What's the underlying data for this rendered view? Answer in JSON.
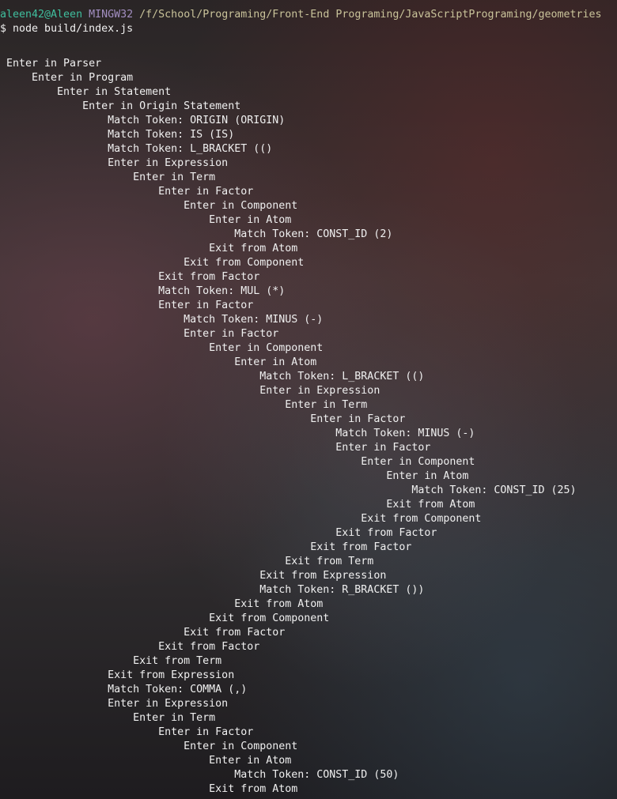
{
  "prompt": {
    "user": "aleen42@Aleen",
    "system": "MINGW32",
    "path": "/f/School/Programing/Front-End Programing/JavaScriptPrograming/geometries",
    "symbol": "$",
    "command": "node build/index.js"
  },
  "colors": {
    "user": "#3fbf9e",
    "system": "#a38fc2",
    "path": "#c9c39a",
    "text": "#f0f0f0"
  },
  "output": [
    "Enter in Parser",
    "    Enter in Program",
    "        Enter in Statement",
    "            Enter in Origin Statement",
    "                Match Token: ORIGIN (ORIGIN)",
    "                Match Token: IS (IS)",
    "                Match Token: L_BRACKET (()",
    "                Enter in Expression",
    "                    Enter in Term",
    "                        Enter in Factor",
    "                            Enter in Component",
    "                                Enter in Atom",
    "                                    Match Token: CONST_ID (2)",
    "                                Exit from Atom",
    "                            Exit from Component",
    "                        Exit from Factor",
    "                        Match Token: MUL (*)",
    "                        Enter in Factor",
    "                            Match Token: MINUS (-)",
    "                            Enter in Factor",
    "                                Enter in Component",
    "                                    Enter in Atom",
    "                                        Match Token: L_BRACKET (()",
    "                                        Enter in Expression",
    "                                            Enter in Term",
    "                                                Enter in Factor",
    "                                                    Match Token: MINUS (-)",
    "                                                    Enter in Factor",
    "                                                        Enter in Component",
    "                                                            Enter in Atom",
    "                                                                Match Token: CONST_ID (25)",
    "                                                            Exit from Atom",
    "                                                        Exit from Component",
    "                                                    Exit from Factor",
    "                                                Exit from Factor",
    "                                            Exit from Term",
    "                                        Exit from Expression",
    "                                        Match Token: R_BRACKET ())",
    "                                    Exit from Atom",
    "                                Exit from Component",
    "                            Exit from Factor",
    "                        Exit from Factor",
    "                    Exit from Term",
    "                Exit from Expression",
    "                Match Token: COMMA (,)",
    "                Enter in Expression",
    "                    Enter in Term",
    "                        Enter in Factor",
    "                            Enter in Component",
    "                                Enter in Atom",
    "                                    Match Token: CONST_ID (50)",
    "                                Exit from Atom"
  ]
}
